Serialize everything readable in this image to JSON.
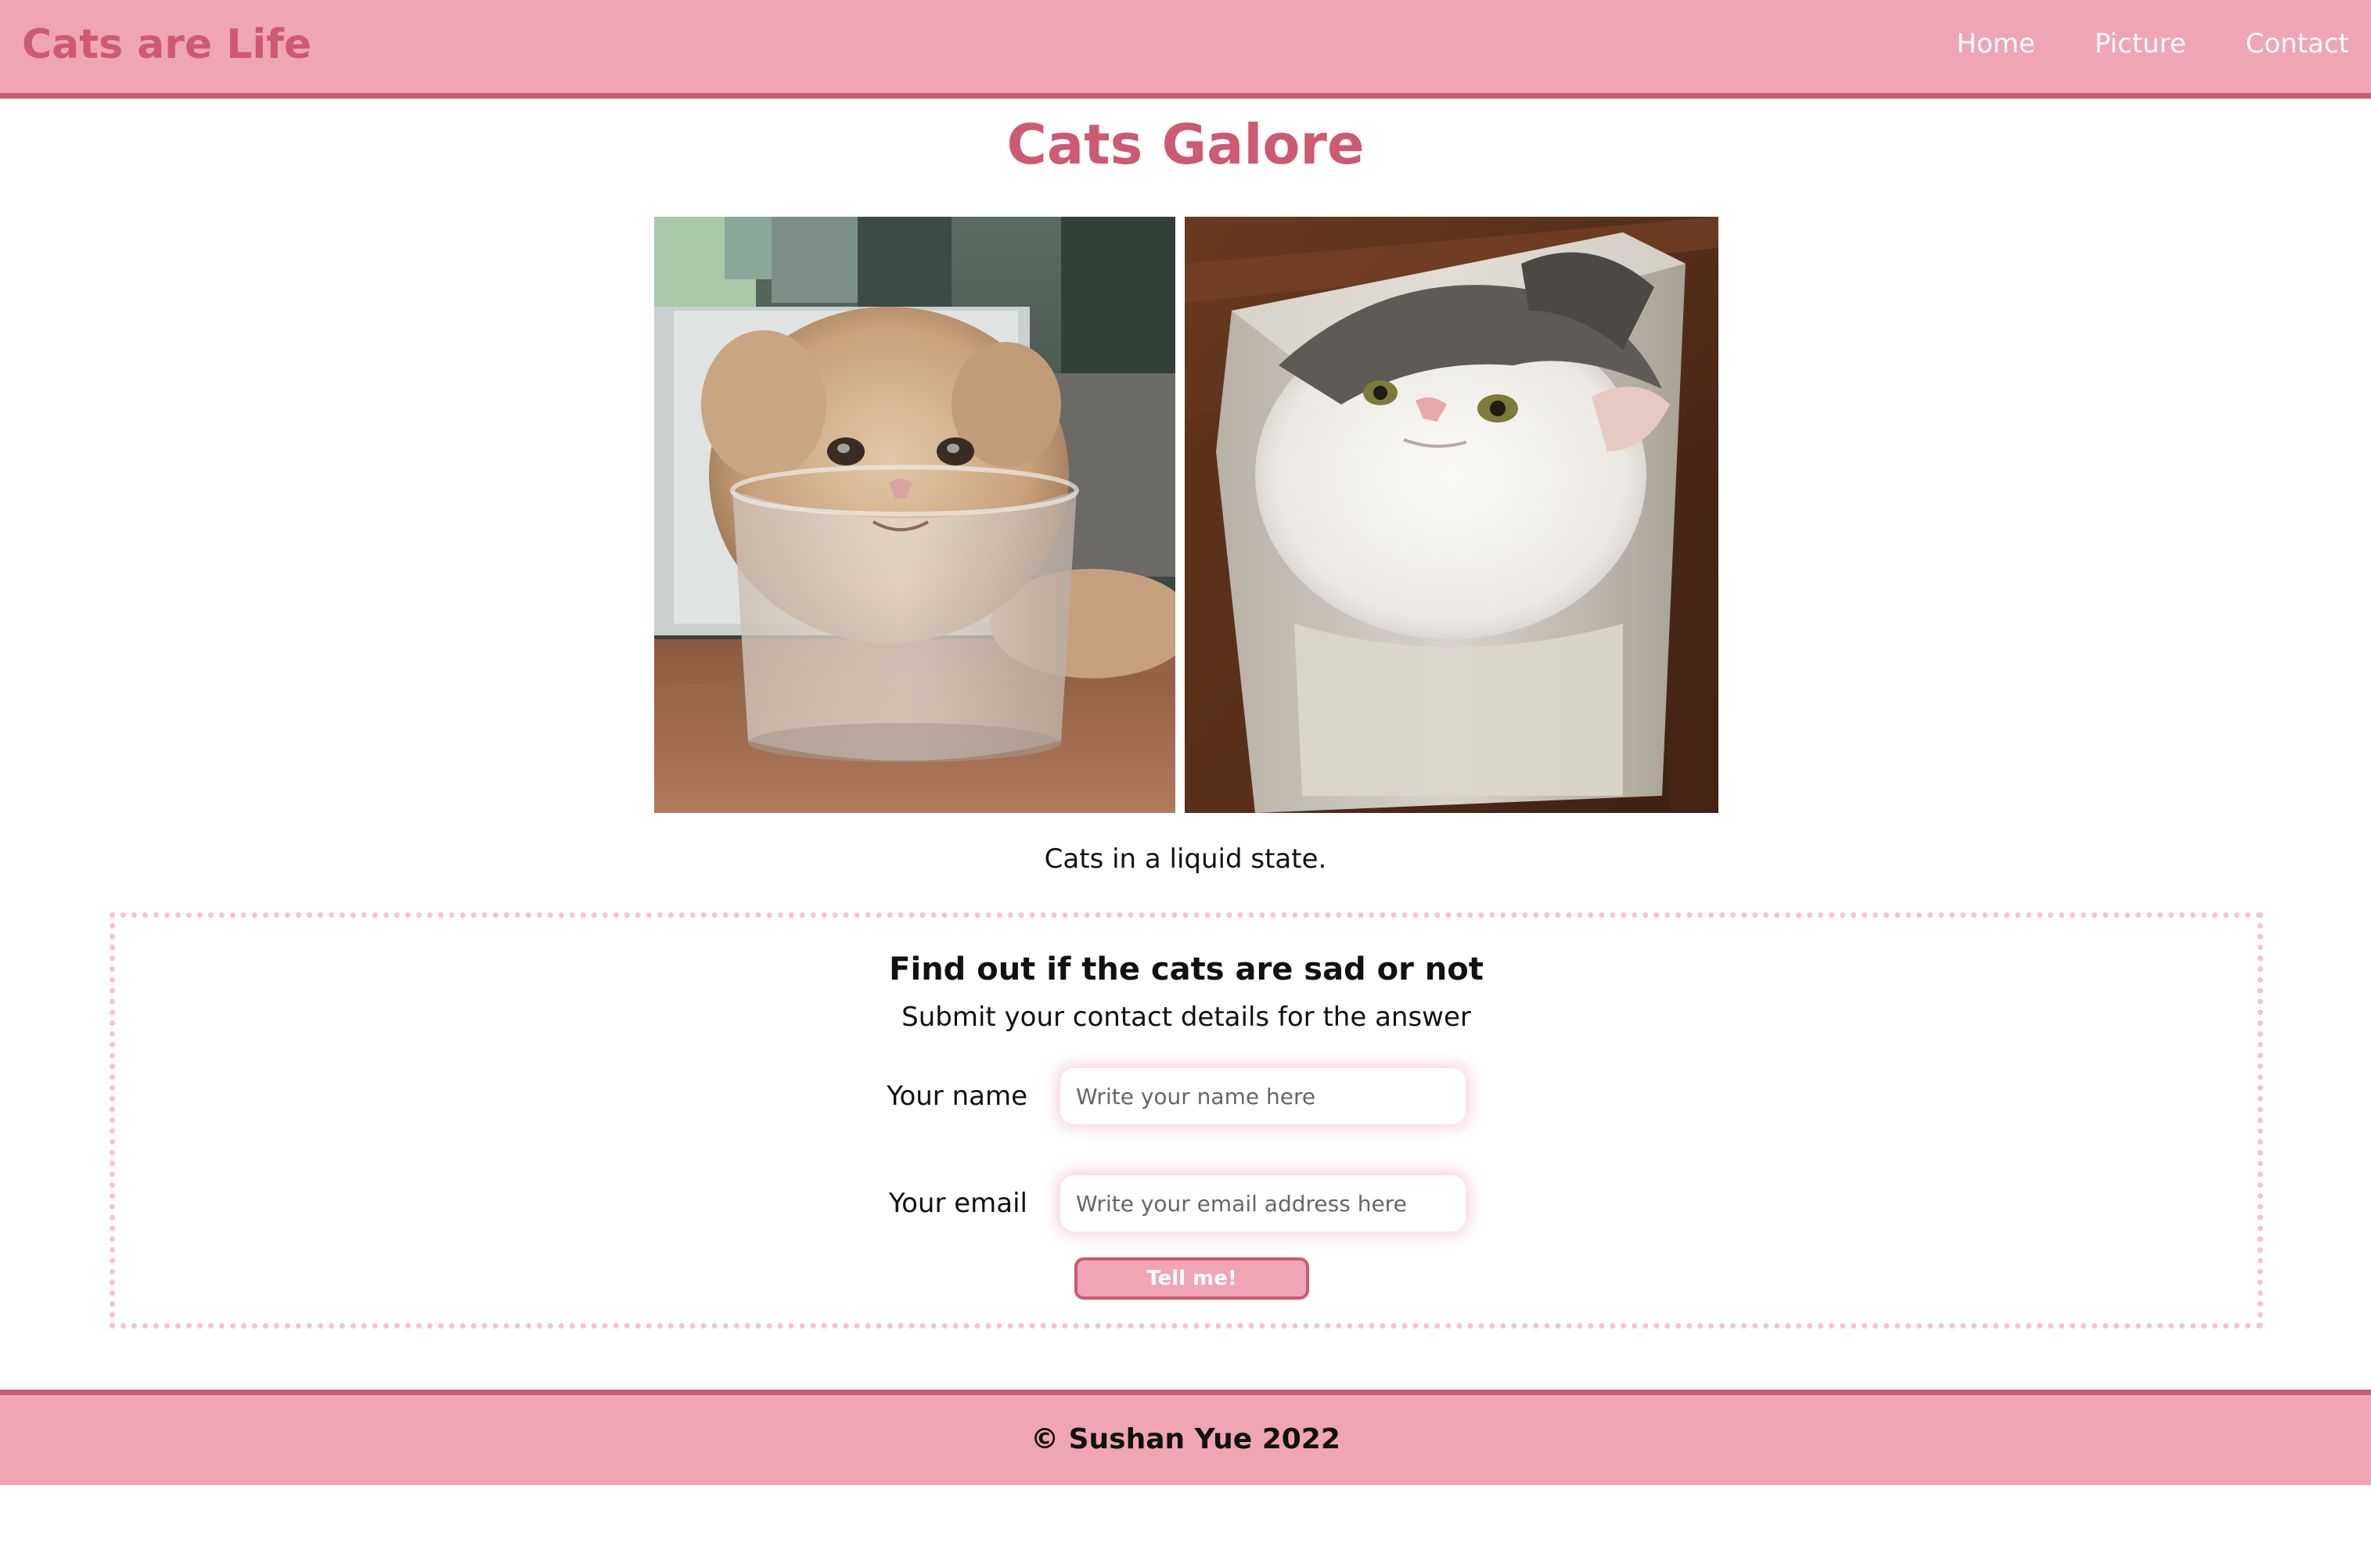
{
  "header": {
    "brand": "Cats are Life",
    "nav": [
      "Home",
      "Picture",
      "Contact"
    ]
  },
  "main": {
    "title": "Cats Galore",
    "photos": [
      {
        "icon": "cat-in-glass-photo"
      },
      {
        "icon": "cat-in-plastic-bin-photo"
      }
    ],
    "caption": "Cats in a liquid state."
  },
  "form": {
    "heading": "Find out if the cats are sad or not",
    "subheading": "Submit your contact details for the answer",
    "name_label": "Your name",
    "name_placeholder": "Write your name here",
    "name_value": "",
    "email_label": "Your email",
    "email_placeholder": "Write your email address here",
    "email_value": "",
    "submit_label": "Tell me!"
  },
  "footer": {
    "text": "© Sushan Yue 2022"
  },
  "colors": {
    "pink": "#f0a5b4",
    "rose": "#cc5a70",
    "dotted_border": "#f4c4cb"
  }
}
